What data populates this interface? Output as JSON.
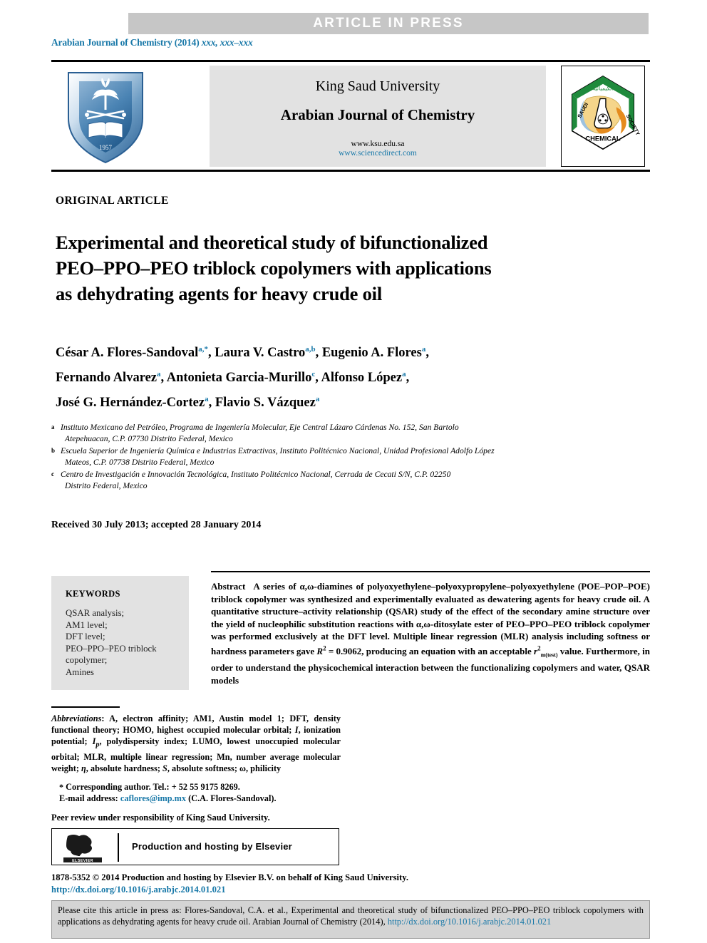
{
  "banner": {
    "text": "ARTICLE  IN  PRESS",
    "bg_color": "#c6c6c6",
    "text_color": "#ffffff"
  },
  "journal_ref": {
    "prefix": "Arabian Journal of Chemistry (2014)",
    "volume_pages": "xxx, xxx–xxx",
    "color": "#1878a8"
  },
  "header": {
    "university": "King Saud University",
    "journal_title": "Arabian Journal of Chemistry",
    "url_ksu": "www.ksu.edu.sa",
    "url_sciencedirect": "www.sciencedirect.com",
    "ksu_logo_name": "king-saud-university-shield-logo",
    "ksu_logo_year": "1957",
    "scs_logo_name": "saudi-chemical-society-hexagon-logo",
    "scs_logo_labels": {
      "left": "SAUDI",
      "right": "SOCIETY",
      "bottom": "CHEMICAL"
    }
  },
  "article": {
    "type": "ORIGINAL ARTICLE",
    "title": "Experimental and theoretical study of bifunctionalized PEO–PPO–PEO triblock copolymers with applications as dehydrating agents for heavy crude oil",
    "title_lines": [
      "Experimental and theoretical study of bifunctionalized",
      "PEO–PPO–PEO triblock copolymers with applications",
      "as dehydrating agents for heavy crude oil"
    ],
    "received_line": "Received 30 July 2013; accepted 28 January 2014"
  },
  "authors": {
    "lines": [
      [
        {
          "name": "César A. Flores-Sandoval",
          "marks": "a,*"
        },
        {
          "name": "Laura V. Castro",
          "marks": "a,b"
        },
        {
          "name": "Eugenio A. Flores",
          "marks": "a"
        }
      ],
      [
        {
          "name": "Fernando Alvarez",
          "marks": "a"
        },
        {
          "name": "Antonieta Garcia-Murillo",
          "marks": "c"
        },
        {
          "name": "Alfonso López",
          "marks": "a"
        }
      ],
      [
        {
          "name": "José G. Hernández-Cortez",
          "marks": "a"
        },
        {
          "name": "Flavio S. Vázquez",
          "marks": "a"
        }
      ]
    ],
    "mark_color": "#1878a8"
  },
  "affiliations": [
    {
      "mark": "a",
      "line1": "Instituto Mexicano del Petróleo, Programa de Ingeniería Molecular, Eje Central Lázaro Cárdenas No. 152, San Bartolo",
      "line2": "Atepehuacan, C.P. 07730 Distrito Federal, Mexico"
    },
    {
      "mark": "b",
      "line1": "Escuela Superior de Ingeniería Química e Industrias Extractivas, Instituto Politécnico Nacional, Unidad Profesional Adolfo López",
      "line2": "Mateos, C.P. 07738 Distrito Federal, Mexico"
    },
    {
      "mark": "c",
      "line1": "Centro de Investigación e Innovación Tecnológica, Instituto Politécnico Nacional, Cerrada de Cecati S/N, C.P. 02250",
      "line2": "Distrito Federal, Mexico"
    }
  ],
  "keywords": {
    "title": "KEYWORDS",
    "items": [
      "QSAR analysis;",
      "AM1 level;",
      "DFT level;",
      "PEO–PPO–PEO triblock",
      "copolymer;",
      "Amines"
    ]
  },
  "abstract": {
    "label": "Abstract",
    "text": "A series of α,ω-diamines of polyoxyethylene–polyoxypropylene–polyoxyethylene (POE–POP–POE) triblock copolymer was synthesized and experimentally evaluated as dewatering agents for heavy crude oil. A quantitative structure–activity relationship (QSAR) study of the effect of the secondary amine structure over the yield of nucleophilic substitution reactions with α,ω-ditosylate ester of PEO–PPO–PEO triblock copolymer was performed exclusively at the DFT level. Multiple linear regression (MLR) analysis including softness or hardness parameters gave R2 = 0.9062, producing an equation with an acceptable r2m(test) value. Furthermore, in order to understand the physicochemical interaction between the functionalizing copolymers and water, QSAR models",
    "r_squared_value": "0.9062"
  },
  "footnotes": {
    "abbrev_label": "Abbreviations",
    "abbrev_text": ": A, electron affinity; AM1, Austin model 1; DFT, density functional theory; HOMO, highest occupied molecular orbital; I, ionization potential; Ip, polydispersity index; LUMO, lowest unoccupied molecular orbital; MLR, multiple linear regression; Mn, number average molecular weight; η, absolute hardness; S, absolute softness; ω, philicity",
    "corresponding": "Corresponding author. Tel.: + 52 55 9175 8269.",
    "email_label": "E-mail address:",
    "email": "caflores@imp.mx",
    "email_suffix": "(C.A. Flores-Sandoval).",
    "peer_review": "Peer review under responsibility of King Saud University."
  },
  "elsevier_box": {
    "text": "Production and hosting by Elsevier",
    "logo_name": "elsevier-tree-logo",
    "logo_label": "ELSEVIER"
  },
  "copyright": {
    "line": "1878-5352 © 2014 Production and hosting by Elsevier B.V. on behalf of King Saud University.",
    "doi": "http://dx.doi.org/10.1016/j.arabjc.2014.01.021"
  },
  "citation_box": {
    "text_before": "Please cite this article in press as: Flores-Sandoval, C.A. et al., Experimental and theoretical study of bifunctionalized PEO–PPO–PEO triblock copolymers with applications as dehydrating agents for heavy crude oil. Arabian Journal of Chemistry (2014),",
    "link": "http://dx.doi.org/10.1016/j.arabjc.2014.01.021",
    "bg_color": "#d4d4d4"
  }
}
